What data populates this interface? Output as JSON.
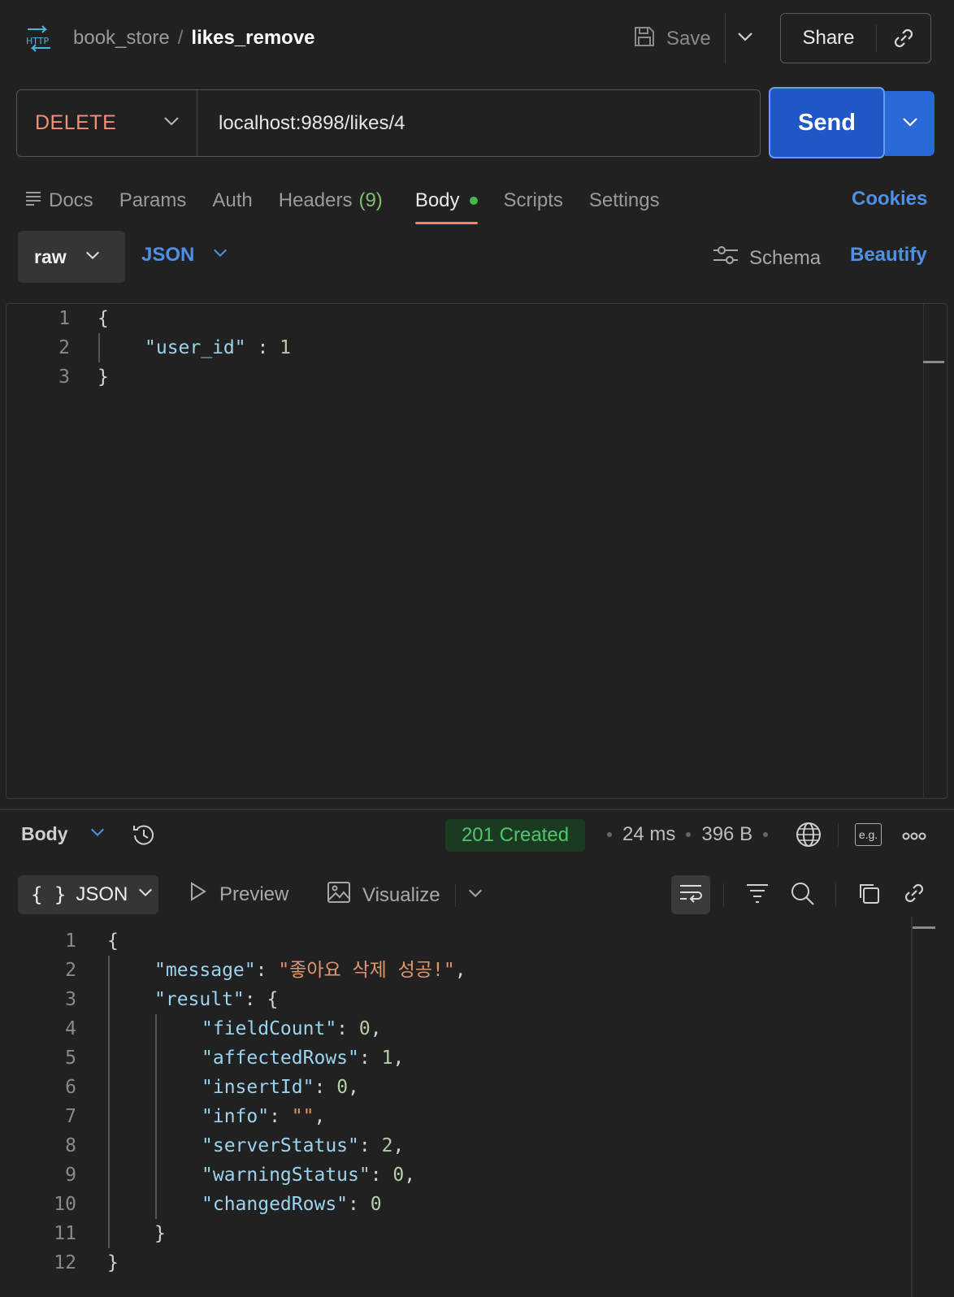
{
  "header": {
    "collection": "book_store",
    "separator": "/",
    "request_name": "likes_remove",
    "save_label": "Save",
    "share_label": "Share"
  },
  "request": {
    "method": "DELETE",
    "url": "localhost:9898/likes/4",
    "send_label": "Send"
  },
  "tabs": {
    "docs": "Docs",
    "params": "Params",
    "auth": "Auth",
    "headers": "Headers",
    "headers_count": "(9)",
    "body": "Body",
    "scripts": "Scripts",
    "settings": "Settings",
    "cookies": "Cookies"
  },
  "body_options": {
    "mode": "raw",
    "language": "JSON",
    "schema": "Schema",
    "beautify": "Beautify"
  },
  "request_body": {
    "line_numbers": [
      "1",
      "2",
      "3"
    ],
    "open_brace": "{",
    "key": "\"user_id\"",
    "colon": " : ",
    "value": "1",
    "close_brace": "}"
  },
  "response": {
    "section_label": "Body",
    "status": "201 Created",
    "time": "24 ms",
    "size": "396 B",
    "eg_label": "e.g.",
    "format": "JSON",
    "preview": "Preview",
    "visualize": "Visualize",
    "line_numbers": [
      "1",
      "2",
      "3",
      "4",
      "5",
      "6",
      "7",
      "8",
      "9",
      "10",
      "11",
      "12"
    ],
    "message_key": "\"message\"",
    "message_value": "\"좋아요 삭제 성공!\"",
    "result_key": "\"result\"",
    "fields": [
      {
        "key": "\"fieldCount\"",
        "value": "0",
        "type": "num",
        "sep": ","
      },
      {
        "key": "\"affectedRows\"",
        "value": "1",
        "type": "num",
        "sep": ","
      },
      {
        "key": "\"insertId\"",
        "value": "0",
        "type": "num",
        "sep": ","
      },
      {
        "key": "\"info\"",
        "value": "\"\"",
        "type": "str",
        "sep": ","
      },
      {
        "key": "\"serverStatus\"",
        "value": "2",
        "type": "num",
        "sep": ","
      },
      {
        "key": "\"warningStatus\"",
        "value": "0",
        "type": "num",
        "sep": ","
      },
      {
        "key": "\"changedRows\"",
        "value": "0",
        "type": "num",
        "sep": ""
      }
    ]
  },
  "colors": {
    "method": "#f0927a",
    "send": "#1f57c6",
    "accent_blue": "#4f8fe6",
    "status_green": "#52c46e",
    "active_tab_underline": "#f0855f"
  }
}
